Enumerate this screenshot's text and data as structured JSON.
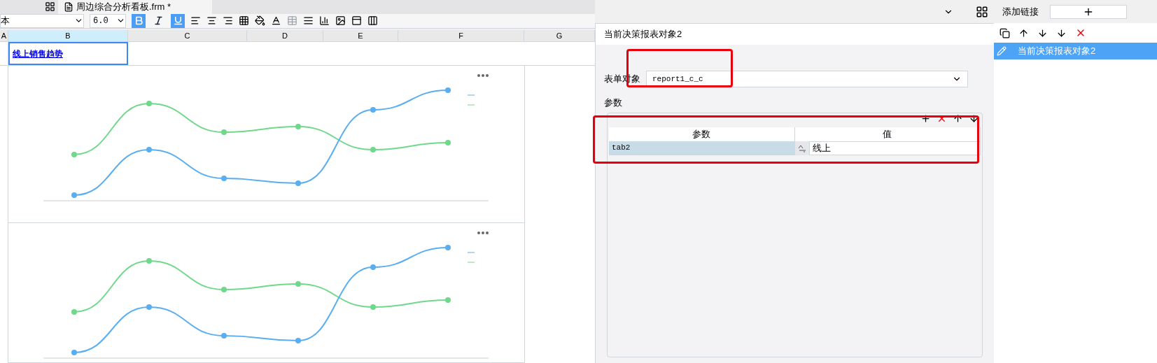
{
  "tab": {
    "title": "周边综合分析看板.frm *"
  },
  "toolbar": {
    "font": "本",
    "font_size": "6.0",
    "bold": true,
    "italic": false,
    "underline": true
  },
  "columns": [
    {
      "label": "A",
      "selected": false
    },
    {
      "label": "B",
      "selected": true
    },
    {
      "label": "C",
      "selected": false
    },
    {
      "label": "D",
      "selected": false
    },
    {
      "label": "E",
      "selected": false
    },
    {
      "label": "F",
      "selected": false
    },
    {
      "label": "G",
      "selected": false
    }
  ],
  "cell_title": "线上销售趋势",
  "dialog": {
    "title": "当前决策报表对象2",
    "form_label": "表单对象",
    "form_value": "report1_c_c",
    "params_label": "参数",
    "table": {
      "columns": [
        "参数",
        "值"
      ],
      "rows": [
        {
          "name": "tab2",
          "value": "线上"
        }
      ]
    }
  },
  "link_panel": {
    "label": "添加链接",
    "items": [
      {
        "label": "当前决策报表对象2",
        "selected": true
      }
    ]
  }
}
